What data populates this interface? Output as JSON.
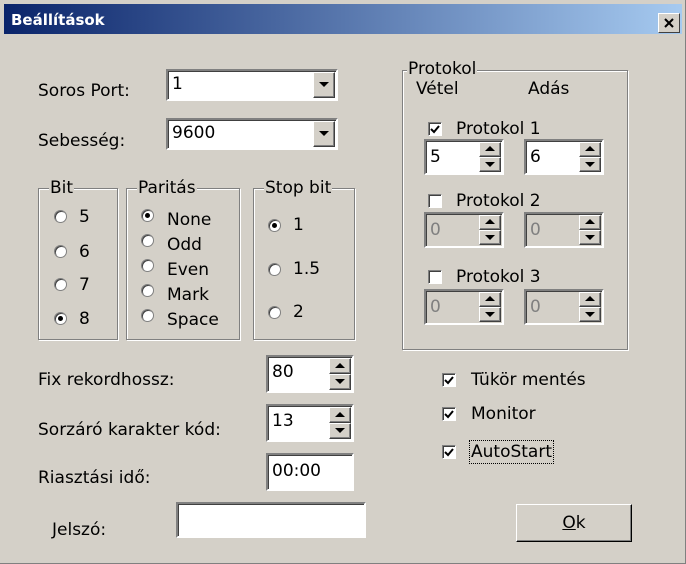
{
  "window": {
    "title": "Beállítások"
  },
  "serial_port": {
    "label": "Soros Port:",
    "value": "1"
  },
  "speed": {
    "label": "Sebesség:",
    "value": "9600"
  },
  "bit_group": {
    "title": "Bit",
    "options": [
      "5",
      "6",
      "7",
      "8"
    ],
    "selected": "8"
  },
  "parity_group": {
    "title": "Paritás",
    "options": [
      "None",
      "Odd",
      "Even",
      "Mark",
      "Space"
    ],
    "selected": "None"
  },
  "stopbit_group": {
    "title": "Stop bit",
    "options": [
      "1",
      "1.5",
      "2"
    ],
    "selected": "1"
  },
  "protocol_group": {
    "title": "Protokol",
    "col_receive": "Vétel",
    "col_send": "Adás",
    "items": [
      {
        "label": "Protokol 1",
        "checked": true,
        "receive": "5",
        "send": "6",
        "enabled": true
      },
      {
        "label": "Protokol 2",
        "checked": false,
        "receive": "0",
        "send": "0",
        "enabled": false
      },
      {
        "label": "Protokol 3",
        "checked": false,
        "receive": "0",
        "send": "0",
        "enabled": false
      }
    ]
  },
  "fixed_record": {
    "label": "Fix rekordhossz:",
    "value": "80"
  },
  "line_end_char": {
    "label": "Sorzáró karakter kód:",
    "value": "13"
  },
  "alarm_time": {
    "label": "Riasztási idő:",
    "value": "00:00"
  },
  "password": {
    "label": "Jelszó:",
    "value": ""
  },
  "options": [
    {
      "label": "Tükör mentés",
      "checked": true
    },
    {
      "label": "Monitor",
      "checked": true
    },
    {
      "label": "AutoStart",
      "checked": true
    }
  ],
  "ok_button": {
    "label": "Ok"
  },
  "icons": {
    "close": "close-icon",
    "dropdown": "chevron-down-icon",
    "spin_up": "spin-up-icon",
    "spin_down": "spin-down-icon",
    "checkmark": "checkmark-icon"
  }
}
